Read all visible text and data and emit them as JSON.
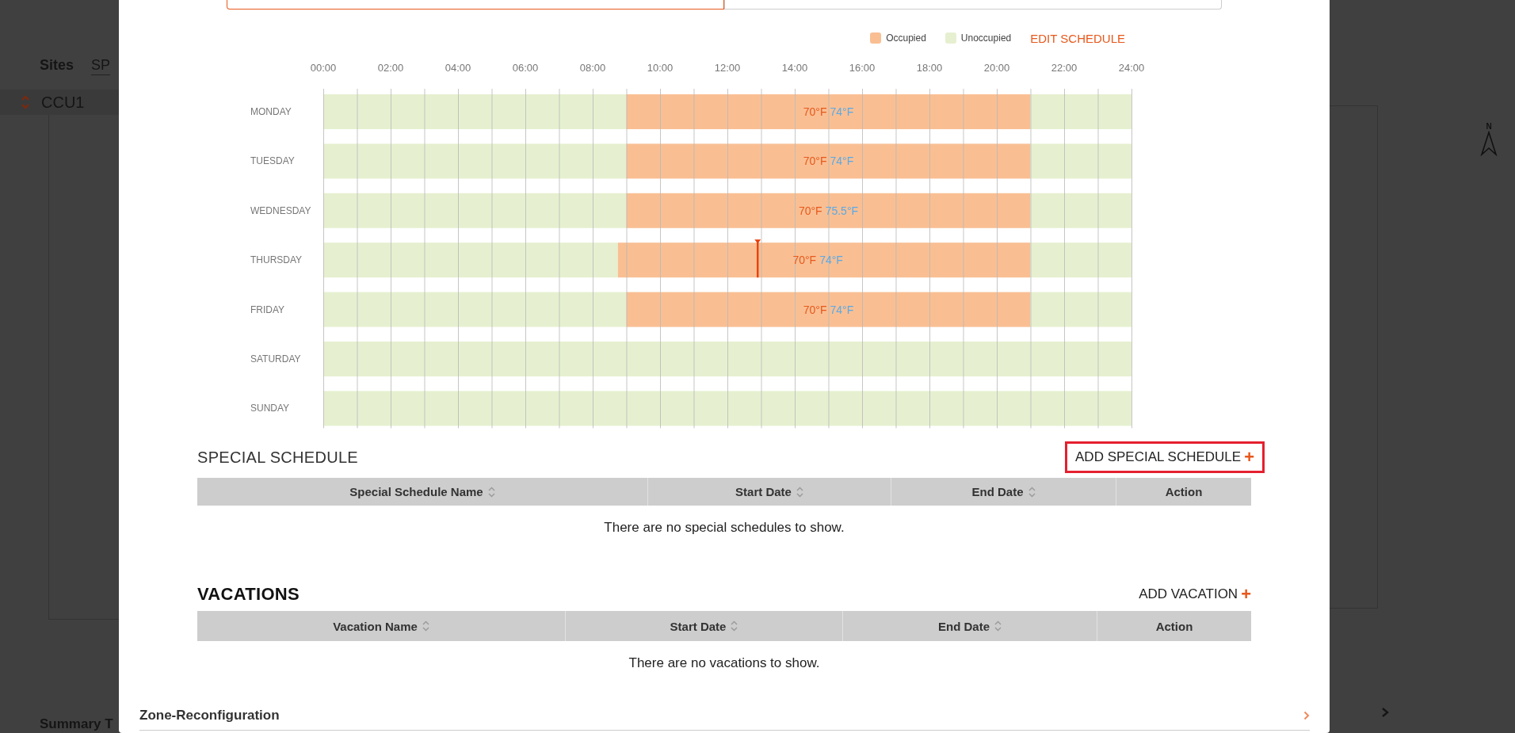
{
  "background": {
    "nav": [
      {
        "label": "Sites",
        "selected": true
      },
      {
        "label": "SP",
        "selected": false
      }
    ],
    "site_row": {
      "label": "CCU1"
    },
    "bottom_section": {
      "label": "Summary T"
    },
    "compass": {
      "label": "N"
    }
  },
  "modal": {
    "segments": [
      {
        "selected": true
      },
      {
        "selected": false
      }
    ],
    "edit_link": "EDIT SCHEDULE",
    "schedule": {
      "chart_data": {
        "type": "bar",
        "orientation": "horizontal",
        "stacked": true,
        "categories": [
          "MONDAY",
          "TUESDAY",
          "WEDNESDAY",
          "THURSDAY",
          "FRIDAY",
          "SATURDAY",
          "SUNDAY"
        ],
        "xlim": [
          0,
          24
        ],
        "grid": true,
        "xticks": [
          {
            "value": 0,
            "label": "00:00"
          },
          {
            "value": 2,
            "label": "02:00"
          },
          {
            "value": 4,
            "label": "04:00"
          },
          {
            "value": 6,
            "label": "06:00"
          },
          {
            "value": 8,
            "label": "08:00"
          },
          {
            "value": 10,
            "label": "10:00"
          },
          {
            "value": 12,
            "label": "12:00"
          },
          {
            "value": 14,
            "label": "14:00"
          },
          {
            "value": 16,
            "label": "16:00"
          },
          {
            "value": 18,
            "label": "18:00"
          },
          {
            "value": 20,
            "label": "20:00"
          },
          {
            "value": 22,
            "label": "22:00"
          },
          {
            "value": 24,
            "label": "24:00"
          }
        ],
        "series": [
          {
            "name": "Unoccupied",
            "color": "#e6f0d0",
            "values": [
              9,
              9,
              9,
              8.75,
              9,
              24,
              24
            ]
          },
          {
            "name": "Occupied",
            "color": "#f9bf93",
            "values": [
              12,
              12,
              12,
              12.25,
              12,
              null,
              null
            ]
          },
          {
            "color": "#e6f0d0",
            "values": [
              3,
              3,
              3,
              3,
              3,
              null,
              null
            ]
          }
        ]
      },
      "setpoints": [
        {
          "heating": "70°F",
          "cooling": "74°F"
        },
        {
          "heating": "70°F",
          "cooling": "74°F"
        },
        {
          "heating": "70°F",
          "cooling": "75.5°F"
        },
        {
          "heating": "70°F",
          "cooling": "74°F",
          "current_time_marker": {
            "level": 0.5375
          }
        },
        {
          "heating": "70°F",
          "cooling": "74°F"
        }
      ]
    },
    "sections": [
      {
        "kind": "special",
        "title": "SPECIAL SCHEDULE",
        "add_button": {
          "label": "ADD SPECIAL SCHEDULE",
          "icon": "+",
          "highlighted": true
        },
        "columns": [
          "Special Schedule Name",
          "Start Date",
          "End Date",
          "Action"
        ],
        "empty_message": "There are no special schedules to show."
      },
      {
        "kind": "vacation",
        "title": "VACATIONS",
        "add_button": {
          "label": "ADD VACATION",
          "icon": "+",
          "highlighted": false
        },
        "columns": [
          "Vacation Name",
          "Start Date",
          "End Date",
          "Action"
        ],
        "empty_message": "There are no vacations to show."
      }
    ],
    "accordion": {
      "label": "Zone-Reconfiguration",
      "expanded": false
    }
  }
}
